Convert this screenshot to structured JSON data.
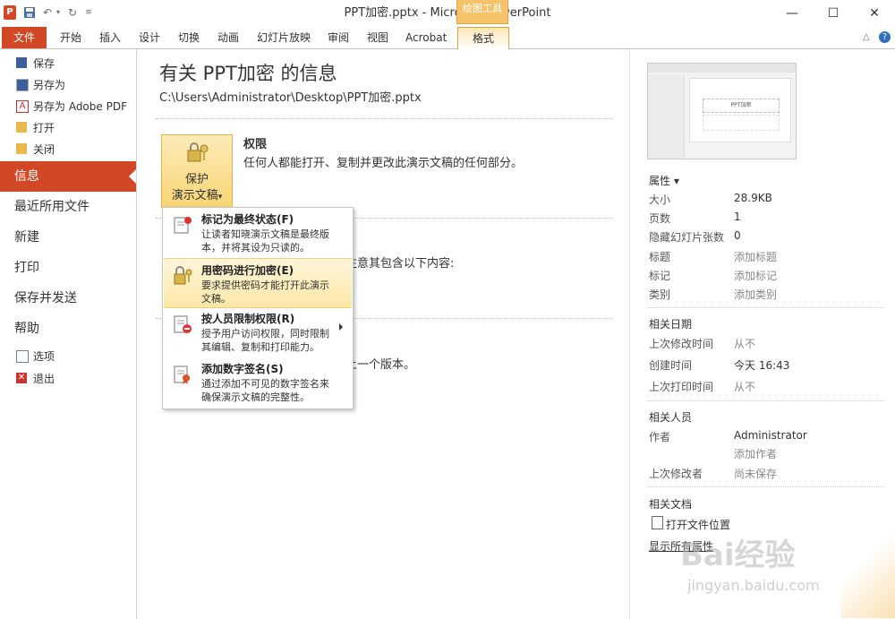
{
  "window": {
    "title": "PPT加密.pptx - Microsoft PowerPoint",
    "context_tab_group": "绘图工具",
    "app_icon_text": "P",
    "qat": {
      "save_icon": "save-icon",
      "undo_icon": "undo-icon",
      "redo_icon": "redo-icon",
      "customize_icon": "customize-icon"
    },
    "controls": {
      "minimize": "—",
      "maximize": "☐",
      "close": "✕"
    }
  },
  "ribbon": {
    "file_tab": "文件",
    "tabs": [
      "开始",
      "插入",
      "设计",
      "切换",
      "动画",
      "幻灯片放映",
      "审阅",
      "视图",
      "Acrobat"
    ],
    "context_tab": "格式",
    "right_icons": {
      "minimize_ribbon": "△",
      "help": "?"
    }
  },
  "leftnav": {
    "small_top": [
      {
        "label": "保存",
        "icon": "save-icon"
      },
      {
        "label": "另存为",
        "icon": "save-as-icon"
      },
      {
        "label": "另存为 Adobe PDF",
        "icon": "pdf-icon"
      },
      {
        "label": "打开",
        "icon": "folder-icon"
      },
      {
        "label": "关闭",
        "icon": "close-folder-icon"
      }
    ],
    "big": [
      {
        "label": "信息"
      },
      {
        "label": "最近所用文件"
      },
      {
        "label": "新建"
      },
      {
        "label": "打印"
      },
      {
        "label": "保存并发送"
      },
      {
        "label": "帮助"
      }
    ],
    "small_bottom": [
      {
        "label": "选项",
        "icon": "options-icon"
      },
      {
        "label": "退出",
        "icon": "exit-icon"
      }
    ]
  },
  "main": {
    "title": "有关 PPT加密 的信息",
    "path": "C:\\Users\\Administrator\\Desktop\\PPT加密.pptx",
    "protect": {
      "label1": "保护",
      "label2": "演示文稿",
      "caret": "▾"
    },
    "permissions": {
      "title": "权限",
      "desc": "任何人都能打开、复制并更改此演示文稿的任何部分。"
    },
    "prepare_fragment": "注意其包含以下内容:",
    "versions_fragment": "上一个版本。"
  },
  "dropdown": {
    "items": [
      {
        "title": "标记为最终状态(F)",
        "desc1": "让读者知晓演示文稿是最终版",
        "desc2": "本，并将其设为只读的。",
        "icon": "mark-final-icon"
      },
      {
        "title": "用密码进行加密(E)",
        "desc1": "要求提供密码才能打开此演示",
        "desc2": "文稿。",
        "icon": "encrypt-lock-icon"
      },
      {
        "title": "按人员限制权限(R)",
        "desc1": "授予用户访问权限，同时限制",
        "desc2": "其编辑、复制和打印能力。",
        "icon": "restrict-permission-icon"
      },
      {
        "title": "添加数字签名(S)",
        "desc1": "通过添加不可见的数字签名来",
        "desc2": "确保演示文稿的完整性。",
        "icon": "digital-signature-icon"
      }
    ]
  },
  "rightpanel": {
    "thumb_text": "PPT加密",
    "properties_header": "属性 ▾",
    "properties": [
      {
        "key": "大小",
        "value": "28.9KB",
        "placeholder": false
      },
      {
        "key": "页数",
        "value": "1",
        "placeholder": false
      },
      {
        "key": "隐藏幻灯片张数",
        "value": "0",
        "placeholder": false
      },
      {
        "key": "标题",
        "value": "添加标题",
        "placeholder": true
      },
      {
        "key": "标记",
        "value": "添加标记",
        "placeholder": true
      },
      {
        "key": "类别",
        "value": "添加类别",
        "placeholder": true
      }
    ],
    "dates_header": "相关日期",
    "dates": [
      {
        "key": "上次修改时间",
        "value": "从不",
        "placeholder": true
      },
      {
        "key": "创建时间",
        "value": "今天 16:43",
        "placeholder": false
      },
      {
        "key": "上次打印时间",
        "value": "从不",
        "placeholder": true
      }
    ],
    "people_header": "相关人员",
    "people": {
      "author_key": "作者",
      "author_value": "Administrator",
      "add_author": "添加作者",
      "last_modified_key": "上次修改者",
      "last_modified_value": "尚未保存"
    },
    "docs_header": "相关文档",
    "open_location": "打开文件位置",
    "show_all": "显示所有属性"
  },
  "watermark": {
    "line1": "Bai经验",
    "line2": "jingyan.baidu.com"
  },
  "colors": {
    "file_accent": "#d24726",
    "highlight": "#fde8a8",
    "context_tab": "#f6c26a"
  }
}
